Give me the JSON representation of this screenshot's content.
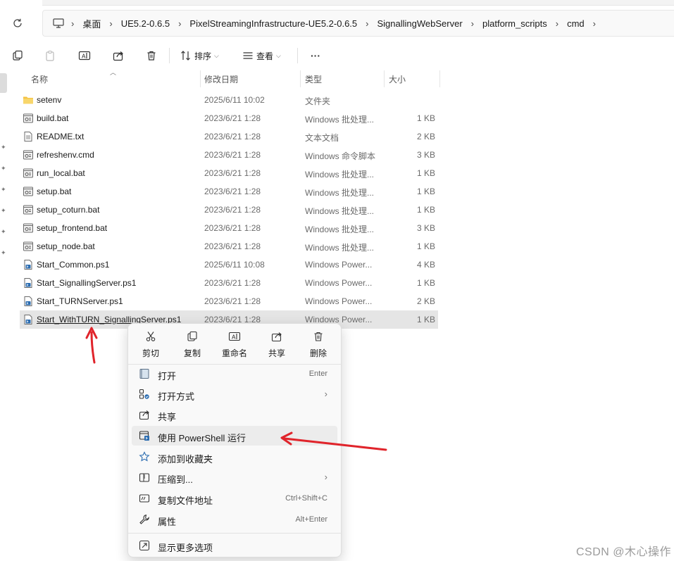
{
  "breadcrumb": {
    "items": [
      "桌面",
      "UE5.2-0.6.5",
      "PixelStreamingInfrastructure-UE5.2-0.6.5",
      "SignallingWebServer",
      "platform_scripts",
      "cmd"
    ]
  },
  "toolbar": {
    "sort_label": "排序",
    "view_label": "查看",
    "more_label": "···"
  },
  "columns": {
    "name": "名称",
    "modified": "修改日期",
    "type": "类型",
    "size": "大小"
  },
  "files": [
    {
      "name": "setenv",
      "modified": "2025/6/11 10:02",
      "type": "文件夹",
      "size": "",
      "icon": "folder-icon"
    },
    {
      "name": "build.bat",
      "modified": "2023/6/21 1:28",
      "type": "Windows 批处理...",
      "size": "1 KB",
      "icon": "batch-file-icon"
    },
    {
      "name": "README.txt",
      "modified": "2023/6/21 1:28",
      "type": "文本文档",
      "size": "2 KB",
      "icon": "text-file-icon"
    },
    {
      "name": "refreshenv.cmd",
      "modified": "2023/6/21 1:28",
      "type": "Windows 命令脚本",
      "size": "3 KB",
      "icon": "batch-file-icon"
    },
    {
      "name": "run_local.bat",
      "modified": "2023/6/21 1:28",
      "type": "Windows 批处理...",
      "size": "1 KB",
      "icon": "batch-file-icon"
    },
    {
      "name": "setup.bat",
      "modified": "2023/6/21 1:28",
      "type": "Windows 批处理...",
      "size": "1 KB",
      "icon": "batch-file-icon"
    },
    {
      "name": "setup_coturn.bat",
      "modified": "2023/6/21 1:28",
      "type": "Windows 批处理...",
      "size": "1 KB",
      "icon": "batch-file-icon"
    },
    {
      "name": "setup_frontend.bat",
      "modified": "2023/6/21 1:28",
      "type": "Windows 批处理...",
      "size": "3 KB",
      "icon": "batch-file-icon"
    },
    {
      "name": "setup_node.bat",
      "modified": "2023/6/21 1:28",
      "type": "Windows 批处理...",
      "size": "1 KB",
      "icon": "batch-file-icon"
    },
    {
      "name": "Start_Common.ps1",
      "modified": "2025/6/11 10:08",
      "type": "Windows Power...",
      "size": "4 KB",
      "icon": "powershell-file-icon"
    },
    {
      "name": "Start_SignallingServer.ps1",
      "modified": "2023/6/21 1:28",
      "type": "Windows Power...",
      "size": "1 KB",
      "icon": "powershell-file-icon"
    },
    {
      "name": "Start_TURNServer.ps1",
      "modified": "2023/6/21 1:28",
      "type": "Windows Power...",
      "size": "2 KB",
      "icon": "powershell-file-icon"
    },
    {
      "name": "Start_WithTURN_SignallingServer.ps1",
      "modified": "2023/6/21 1:28",
      "type": "Windows Power...",
      "size": "1 KB",
      "icon": "powershell-file-icon"
    }
  ],
  "context_menu": {
    "quick_actions": [
      {
        "label": "剪切",
        "icon": "cut-icon"
      },
      {
        "label": "复制",
        "icon": "copy-icon"
      },
      {
        "label": "重命名",
        "icon": "rename-icon"
      },
      {
        "label": "共享",
        "icon": "share-icon"
      },
      {
        "label": "删除",
        "icon": "delete-icon"
      }
    ],
    "items": [
      {
        "label": "打开",
        "shortcut": "Enter",
        "icon": "open-icon"
      },
      {
        "label": "打开方式",
        "shortcut": "",
        "icon": "open-with-icon"
      },
      {
        "label": "共享",
        "shortcut": "",
        "icon": "share-icon"
      },
      {
        "label": "使用 PowerShell 运行",
        "shortcut": "",
        "icon": "powershell-run-icon"
      },
      {
        "label": "添加到收藏夹",
        "shortcut": "",
        "icon": "star-icon"
      },
      {
        "label": "压缩到...",
        "shortcut": "",
        "icon": "compress-icon"
      },
      {
        "label": "复制文件地址",
        "shortcut": "Ctrl+Shift+C",
        "icon": "copy-path-icon"
      },
      {
        "label": "属性",
        "shortcut": "Alt+Enter",
        "icon": "properties-icon"
      },
      {
        "label": "显示更多选项",
        "shortcut": "",
        "icon": "more-options-icon"
      }
    ]
  },
  "watermark": "CSDN @木心操作",
  "colors": {
    "selection": "#e5e5e5",
    "menu_bg": "#f9f9f9",
    "annotation_red": "#e0242b",
    "folder": "#f5c242",
    "powershell": "#2b6cb0"
  }
}
